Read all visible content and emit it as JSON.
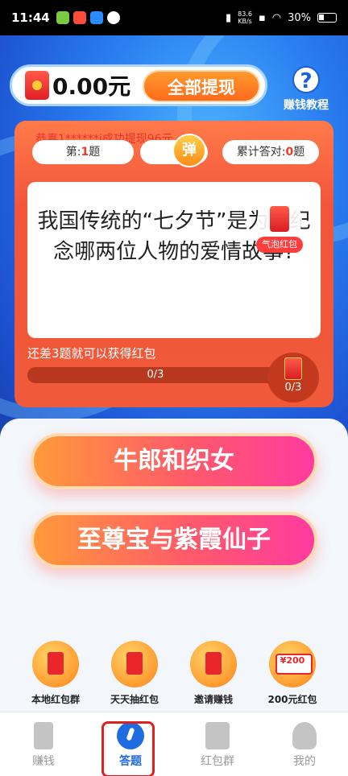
{
  "status_bar": {
    "time": "11:44",
    "net_speed_value": "83.6",
    "net_speed_unit": "KB/s",
    "battery": "30%"
  },
  "wallet": {
    "amount": "0.00元",
    "withdraw_label": "全部提现"
  },
  "help": {
    "label": "赚钱教程",
    "icon": "question-icon"
  },
  "quiz": {
    "ticker": "恭喜1******j成功提现96元",
    "question_index_prefix": "第:",
    "question_index_value": "1",
    "question_index_suffix": "题",
    "danmu_label": "弹",
    "score_prefix": "累计答对:",
    "score_value": "0",
    "score_suffix": "题",
    "question": "我国传统的“七夕节”是为了纪念哪两位人物的爱情故事?",
    "float_envelope_label": "气泡红包",
    "progress_text": "还差3题就可以获得红包",
    "progress_value": "0/3",
    "progress_fraction": 0,
    "reward_count": "0/3"
  },
  "answers": [
    {
      "label": "牛郎和织女"
    },
    {
      "label": "至尊宝与紫霞仙子"
    }
  ],
  "features": [
    {
      "label": "本地红包群",
      "icon": "red-envelope-group-icon"
    },
    {
      "label": "天天抽红包",
      "icon": "lucky-draw-icon"
    },
    {
      "label": "邀请赚钱",
      "icon": "invite-icon"
    },
    {
      "label": "200元红包",
      "icon": "coupon-icon",
      "coupon_text": "¥200"
    }
  ],
  "nav": [
    {
      "label": "赚钱",
      "icon": "battery-icon",
      "active": false
    },
    {
      "label": "答题",
      "icon": "pen-icon",
      "active": true
    },
    {
      "label": "红包群",
      "icon": "bag-icon",
      "active": false
    },
    {
      "label": "我的",
      "icon": "person-icon",
      "active": false
    }
  ],
  "colors": {
    "accent_blue": "#1f6be0",
    "withdraw_orange": "#ff6a1a",
    "card_red": "#f2553a",
    "highlight_red": "#e02020"
  }
}
